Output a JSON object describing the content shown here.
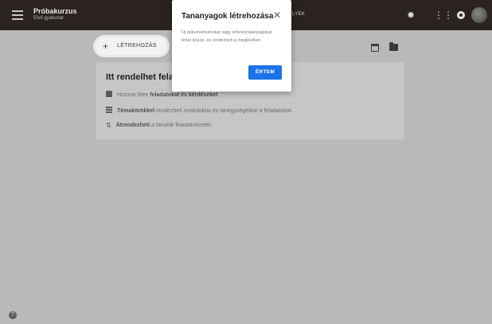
{
  "header": {
    "course_name": "Próbakurzus",
    "course_subtitle": "Első gyakorlat",
    "tab_fragment": "LYEK",
    "icons": [
      "menu-icon",
      "gear-icon",
      "apps-icon",
      "circle-icon",
      "avatar"
    ]
  },
  "toolbar": {
    "create_label": "LÉTREHOZÁS",
    "create_icon": "+"
  },
  "card": {
    "title": "Itt rendelhet felada",
    "rows": [
      {
        "pre": "Hozzon létre ",
        "bold": "feladatokat és kérdéseket",
        "post": ""
      },
      {
        "pre": "",
        "bold": "Témakörökkel",
        "post": " rendezheti modulokba és tanegységekbe a feladatokat."
      },
      {
        "pre": "",
        "bold": "Átrendezheti",
        "post": " a tanulók feladatnézetét."
      }
    ]
  },
  "dialog": {
    "title": "Tananyagok létrehozása",
    "close_glyph": "✕",
    "body": "Új dokumentumokat vagy referenciaanyagokat tehet közzé, és rendezheti a meglévőket.",
    "confirm_label": "ÉRTEM"
  },
  "footer": {
    "help_glyph": "?"
  },
  "colors": {
    "topbar": "#2a231f",
    "scrim_background": "#b9b9b9",
    "primary_button": "#1a73e8"
  }
}
